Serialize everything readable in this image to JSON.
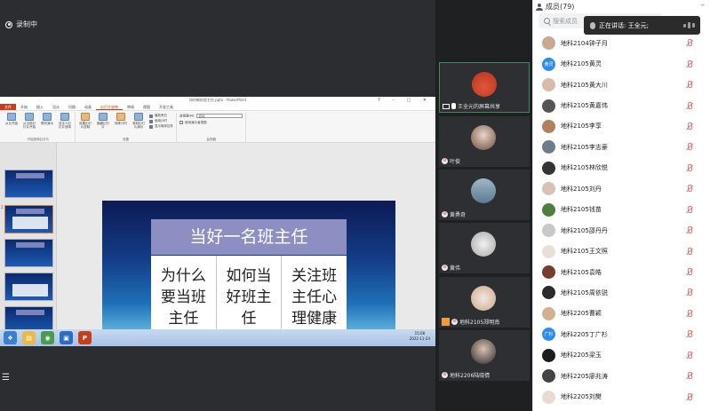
{
  "recording": {
    "label": "录制中"
  },
  "powerpoint": {
    "window_title": "如何做好班主任.pptx - PowerPoint",
    "tabs": [
      "文件",
      "开始",
      "插入",
      "设计",
      "切换",
      "动画",
      "幻灯片放映",
      "审阅",
      "视图",
      "开发工具"
    ],
    "active_tab": "幻灯片放映",
    "ribbon": {
      "start_group": {
        "label": "开始放映幻灯片",
        "buttons": [
          "从头开始",
          "从当前幻灯片开始",
          "联机演示",
          "自定义幻灯片放映"
        ]
      },
      "setup_group": {
        "label": "设置",
        "buttons": [
          "设置幻灯片放映",
          "隐藏幻灯片",
          "排练计时",
          "录制幻灯片演示"
        ],
        "checks": [
          "播放旁白",
          "使用计时",
          "显示媒体控件"
        ]
      },
      "monitor_group": {
        "label": "监视器",
        "monitor_label": "监视器(M):",
        "monitor_value": "自动",
        "presenter_view": "使用演示者视图"
      }
    },
    "slide": {
      "title": "当好一名班主任",
      "cells": [
        "为什么要当班主任",
        "如何当好班主任",
        "关注班主任心理健康"
      ]
    },
    "status_bar": "幻灯片 第 2 张，共 41 张",
    "clock": {
      "time": "15:08",
      "date": "2022-11-24"
    }
  },
  "video_tiles": [
    {
      "name": "王全元的屏幕共享",
      "speaking": true
    },
    {
      "name": "叶俊",
      "speaking": false
    },
    {
      "name": "黄勇奇",
      "speaking": false
    },
    {
      "name": "黄伟",
      "speaking": false
    },
    {
      "name": "地科2105郑明南",
      "speaking": false
    },
    {
      "name": "地科2206陆晓倩",
      "speaking": false
    }
  ],
  "members_panel": {
    "title": "成员(79)",
    "search_placeholder": "搜索成员",
    "speaking_now": "正在讲话: 王全元;",
    "members": [
      {
        "name": "地科2104钟子月",
        "avatar_color": "#c9a98f"
      },
      {
        "name": "地科2105黄灵",
        "avatar_color": "#2d8cf0",
        "avatar_text": "黄灵"
      },
      {
        "name": "地科2105黄大川",
        "avatar_color": "#d9b9a8"
      },
      {
        "name": "地科2105黄嘉伟",
        "avatar_color": "#555555"
      },
      {
        "name": "地科2105李享",
        "avatar_color": "#b47f5c"
      },
      {
        "name": "地科2105李志豪",
        "avatar_color": "#6e7b88"
      },
      {
        "name": "地科2105林欣悦",
        "avatar_color": "#333333"
      },
      {
        "name": "地科2105刘丹",
        "avatar_color": "#d7c2b5"
      },
      {
        "name": "地科2105钱苗",
        "avatar_color": "#4e7f3c"
      },
      {
        "name": "地科2105邵丹丹",
        "avatar_color": "#c8c8c8"
      },
      {
        "name": "地科2105王文照",
        "avatar_color": "#e9dfd6"
      },
      {
        "name": "地科2105袁皓",
        "avatar_color": "#7a3b2e"
      },
      {
        "name": "地科2105周依锐",
        "avatar_color": "#2b2b2b"
      },
      {
        "name": "地科2205曹颖",
        "avatar_color": "#d3b08e"
      },
      {
        "name": "地科2205丁广杉",
        "avatar_color": "#2d8cf0",
        "avatar_text": "广杉"
      },
      {
        "name": "地科2205梁玉",
        "avatar_color": "#1d1d1d"
      },
      {
        "name": "地科2205廖兆涛",
        "avatar_color": "#444444"
      },
      {
        "name": "地科2205刘樊",
        "avatar_color": "#e6dcd3"
      }
    ]
  }
}
